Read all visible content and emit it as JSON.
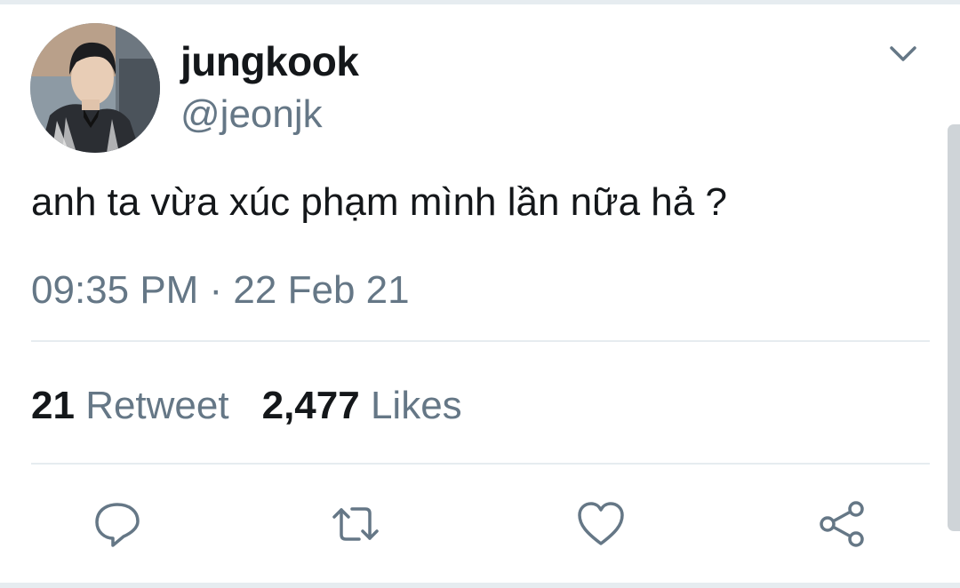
{
  "tweet": {
    "author": {
      "display_name": "jungkook",
      "handle": "@jeonjk"
    },
    "text": "anh ta vừa xúc phạm mình lần nữa hả ?",
    "timestamp": "09:35 PM · 22 Feb 21"
  },
  "stats": {
    "retweets_count": "21",
    "retweets_label": "Retweet",
    "likes_count": "2,477",
    "likes_label": "Likes"
  },
  "icons": {
    "menu": "chevron-down-icon",
    "reply": "reply-icon",
    "retweet": "retweet-icon",
    "like": "heart-icon",
    "share": "share-icon"
  },
  "colors": {
    "text_primary": "#14171a",
    "text_secondary": "#657786",
    "divider": "#e6ecf0",
    "icon": "#657786"
  }
}
